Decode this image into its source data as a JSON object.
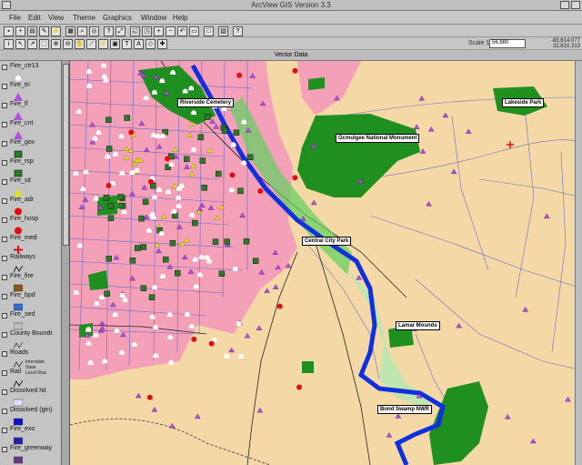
{
  "window": {
    "title": "ArcView GIS Version 3.3"
  },
  "menu": [
    "File",
    "Edit",
    "View",
    "Theme",
    "Graphics",
    "Window",
    "Help"
  ],
  "toolbar": {
    "scale_label": "Scale 1:",
    "scale_value": "56,880",
    "coords": [
      "-83,614.077",
      "32,810.313"
    ]
  },
  "document": {
    "title": "Vector Data"
  },
  "layers": [
    {
      "name": "Fire_ctr13",
      "symbol": "white-blob",
      "color": "#ffffff"
    },
    {
      "name": "Fire_tri",
      "symbol": "triangle",
      "color": "#b050e0"
    },
    {
      "name": "Fire_lf",
      "symbol": "triangle",
      "color": "#b050e0"
    },
    {
      "name": "Fire_cnt",
      "symbol": "triangle",
      "color": "#b050e0"
    },
    {
      "name": "Fire_gov",
      "symbol": "square",
      "color": "#2a7a2a"
    },
    {
      "name": "Fire_rsp",
      "symbol": "square",
      "color": "#2a7a2a"
    },
    {
      "name": "Fire_sit",
      "symbol": "triangle",
      "color": "#e0e020"
    },
    {
      "name": "Fire_adr",
      "symbol": "circle",
      "color": "#e01010"
    },
    {
      "name": "Fire_hosp",
      "symbol": "circle",
      "color": "#e01010"
    },
    {
      "name": "Fire_med",
      "symbol": "cross",
      "color": "#e01010"
    },
    {
      "name": "Railways",
      "symbol": "line",
      "color": "#222222"
    },
    {
      "name": "Fire_fire",
      "symbol": "fill",
      "color": "#8a5a1a"
    },
    {
      "name": "Fire_bpd",
      "symbol": "fill",
      "color": "#3070d0"
    },
    {
      "name": "Fire_sed",
      "symbol": "fill",
      "color": "#c0c0c0"
    },
    {
      "name": "County Boundr",
      "symbol": "line",
      "color": "#555555"
    },
    {
      "name": "Roads",
      "symbol": "roads",
      "color": "#444444",
      "sub": [
        "Interstate",
        "State",
        "Local Roa"
      ]
    },
    {
      "name": "Rail",
      "symbol": "line",
      "color": "#222222"
    },
    {
      "name": "Dissolved hit",
      "symbol": "fill",
      "color": "#e0e0ff"
    },
    {
      "name": "Dissolved (gin)",
      "symbol": "fill",
      "color": "#1010d0"
    },
    {
      "name": "Fire_exo",
      "symbol": "fill",
      "color": "#2222aa"
    },
    {
      "name": "Fire_greenway",
      "symbol": "fill",
      "color": "#6a3a8a"
    }
  ],
  "map_labels": [
    {
      "id": "riverside",
      "text": "Riverside Cemetery"
    },
    {
      "id": "lakeside",
      "text": "Lakeside Park"
    },
    {
      "id": "ocmulgee",
      "text": "Ocmulgee National Monument"
    },
    {
      "id": "central",
      "text": "Central City Park"
    },
    {
      "id": "lamar",
      "text": "Lamar Mounds"
    },
    {
      "id": "bondswamp",
      "text": "Bond Swamp NWR"
    }
  ],
  "colors": {
    "urban": "#f4a0b8",
    "rural": "#f4d9a6",
    "park": "#1f8f1f",
    "river": "#1030e0",
    "roads": "#7070c8"
  }
}
